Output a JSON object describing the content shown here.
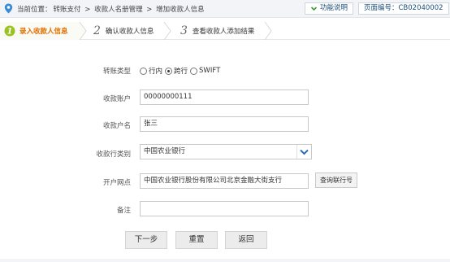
{
  "breadcrumb": {
    "prefix": "当前位置：",
    "items": [
      "转账支付",
      ">",
      "收款人名册管理",
      ">",
      "增加收款人信息"
    ]
  },
  "header_buttons": {
    "help_label": "功能说明",
    "page_no": "页面编号：CB02040002"
  },
  "steps": [
    {
      "num": "1",
      "label": "录入收款人信息",
      "active": true
    },
    {
      "num": "2",
      "label": "确认收款人信息",
      "active": false
    },
    {
      "num": "3",
      "label": "查看收款人添加结果",
      "active": false
    }
  ],
  "form": {
    "transfer_type": {
      "label": "转账类型",
      "options": [
        "行内",
        "跨行",
        "SWIFT"
      ],
      "selected": "跨行"
    },
    "account": {
      "label": "收款账户",
      "value": "00000000111"
    },
    "account_name": {
      "label": "收款户名",
      "value": "张三"
    },
    "bank_type": {
      "label": "收款行类别",
      "value": "中国农业银行"
    },
    "branch": {
      "label": "开户网点",
      "value": "中国农业银行股份有限公司北京金融大街支行",
      "query_button": "查询联行号"
    },
    "remark": {
      "label": "备注",
      "value": ""
    }
  },
  "actions": {
    "next": "下一步",
    "reset": "重置",
    "back": "返回"
  },
  "colors": {
    "accent_green": "#9bc220",
    "active_orange": "#e07000",
    "link_blue": "#1b4f7d",
    "location_icon_blue": "#3a8bd4"
  }
}
